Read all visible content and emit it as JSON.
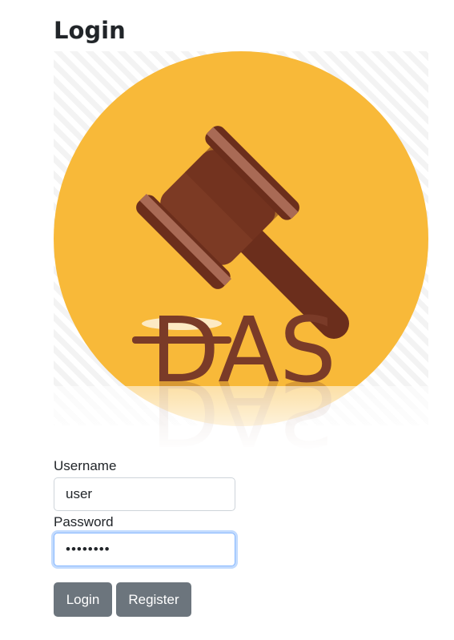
{
  "page": {
    "title": "Login"
  },
  "logo": {
    "text": "DAS",
    "icon": "gavel-icon",
    "colors": {
      "circle": "#F8B939",
      "gavel_dark": "#6B2E1C",
      "gavel_mid": "#7C3A24",
      "band": "#A96A55",
      "text": "#7A3B28"
    }
  },
  "form": {
    "username_label": "Username",
    "username_value": "user",
    "password_label": "Password",
    "password_value": "password"
  },
  "buttons": {
    "login_label": "Login",
    "register_label": "Register",
    "color": "#6C757D"
  }
}
